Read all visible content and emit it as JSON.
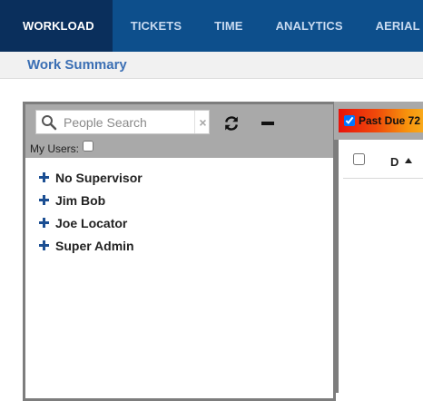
{
  "nav": {
    "tabs": [
      {
        "label": "WORKLOAD",
        "active": true
      },
      {
        "label": "TICKETS",
        "active": false
      },
      {
        "label": "TIME",
        "active": false
      },
      {
        "label": "ANALYTICS",
        "active": false
      },
      {
        "label": "AERIAL PA",
        "active": false
      }
    ],
    "bg_color": "#0d4f8c",
    "active_color": "#0a2f5c"
  },
  "page": {
    "title": "Work Summary"
  },
  "people_panel": {
    "search_placeholder": "People Search",
    "search_value": "",
    "clear_label": "×",
    "my_users_label": "My Users:",
    "my_users_checked": false,
    "icons": {
      "search": "search-icon",
      "refresh": "refresh-icon",
      "collapse": "minus-icon"
    },
    "tree": [
      {
        "label": "No Supervisor"
      },
      {
        "label": "Jim Bob"
      },
      {
        "label": "Joe Locator"
      },
      {
        "label": "Super Admin"
      }
    ]
  },
  "tickets_panel": {
    "past_due_label": "Past Due 72",
    "past_due_checked": true,
    "column_d_label": "D",
    "sort": "ascending"
  }
}
